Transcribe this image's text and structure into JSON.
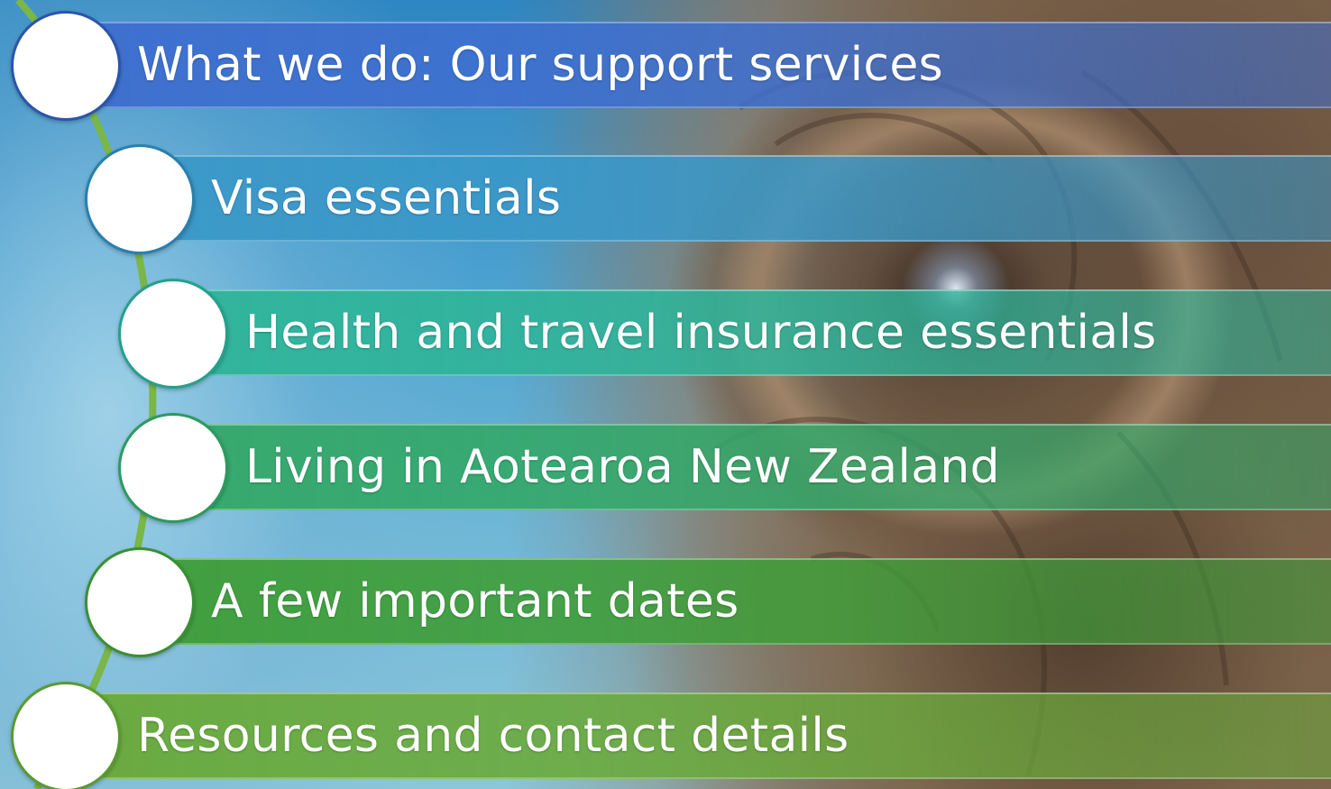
{
  "items": [
    {
      "label": "What we do: Our support services",
      "color": "#3e6fcf",
      "ring": "#2a56a8"
    },
    {
      "label": "Visa essentials",
      "color": "#3a98c8",
      "ring": "#2a7fae"
    },
    {
      "label": "Health and travel insurance essentials",
      "color": "#2fb49a",
      "ring": "#26a08a"
    },
    {
      "label": "Living in Aotearoa New Zealand",
      "color": "#34a86a",
      "ring": "#2d9a60"
    },
    {
      "label": "A few important dates",
      "color": "#3f9e3a",
      "ring": "#3a8f34"
    },
    {
      "label": "Resources and contact details",
      "color": "#6aaa3c",
      "ring": "#5a9a30"
    }
  ],
  "connector_color": "#7ab648"
}
